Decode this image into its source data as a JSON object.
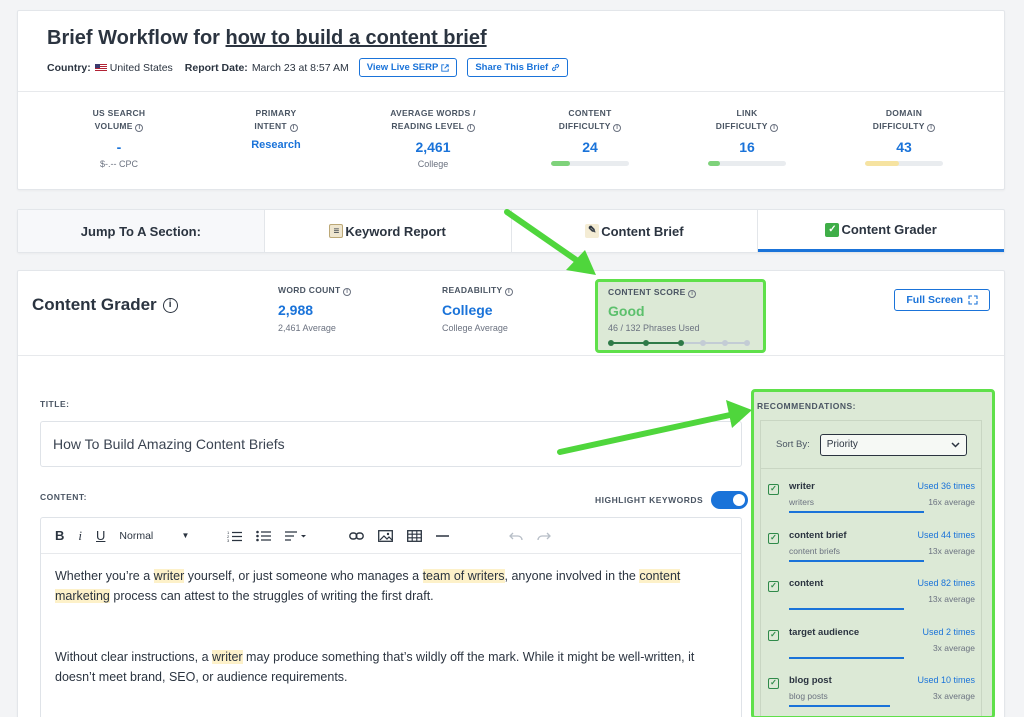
{
  "header": {
    "title_prefix": "Brief Workflow for ",
    "title_topic": "how to build a content brief",
    "country_label": "Country:",
    "country_value": "United States",
    "report_date_label": "Report Date:",
    "report_date_value": "March 23 at 8:57 AM",
    "view_serp_label": "View Live SERP",
    "share_label": "Share This Brief"
  },
  "metrics": {
    "search_volume": {
      "label1": "US SEARCH",
      "label2": "VOLUME",
      "value": "-",
      "sub": "$-.-- CPC"
    },
    "primary_intent": {
      "label1": "PRIMARY",
      "label2": "INTENT",
      "value": "Research"
    },
    "avg_words": {
      "label1": "AVERAGE WORDS /",
      "label2": "READING LEVEL",
      "value": "2,461",
      "sub": "College"
    },
    "content_difficulty": {
      "label1": "CONTENT",
      "label2": "DIFFICULTY",
      "value": "24",
      "level": 0.24
    },
    "link_difficulty": {
      "label1": "LINK",
      "label2": "DIFFICULTY",
      "value": "16",
      "level": 0.16
    },
    "domain_difficulty": {
      "label1": "DOMAIN",
      "label2": "DIFFICULTY",
      "value": "43",
      "level": 0.43
    }
  },
  "colors": {
    "accent": "#1a73d9",
    "good": "#5cc06c",
    "highlight": "#5fe04a",
    "difficulty_low": "#7ed27a",
    "difficulty_mid": "#f6e3a1"
  },
  "tabs": {
    "jump": "Jump To A Section:",
    "keyword_report": "Keyword Report",
    "content_brief": "Content Brief",
    "content_grader": "Content Grader"
  },
  "grader": {
    "title": "Content Grader",
    "word_count": {
      "label": "WORD COUNT",
      "value": "2,988",
      "sub": "2,461 Average"
    },
    "readability": {
      "label": "READABILITY",
      "value": "College",
      "sub": "College Average"
    },
    "content_score": {
      "label": "CONTENT SCORE",
      "value": "Good",
      "sub": "46 / 132 Phrases Used",
      "steps_filled": 3,
      "steps_total": 6
    },
    "full_screen_label": "Full Screen",
    "title_label": "TITLE:",
    "title_value": "How To Build Amazing Content Briefs",
    "content_label": "CONTENT:",
    "highlight_label": "HIGHLIGHT KEYWORDS",
    "toolbar": {
      "format": "Normal"
    },
    "paragraph1": {
      "t1": "Whether you’re a ",
      "k1": "writer",
      "t2": " yourself, or just someone who manages a ",
      "k2": "team of writers",
      "t3": ", anyone involved in the ",
      "k3": "content marketing",
      "t4": " process can attest to the struggles of writing the first draft."
    },
    "paragraph2": {
      "t1": "Without clear instructions, a ",
      "k1": "writer",
      "t2": " may produce something that’s wildly off the mark. While it might be well-written, it doesn’t meet brand, SEO, or audience requirements."
    }
  },
  "recommendations": {
    "label": "RECOMMENDATIONS:",
    "sort_label": "Sort By:",
    "sort_value": "Priority",
    "items": [
      {
        "name": "writer",
        "used": "Used 36 times",
        "variant": "writers",
        "avg": "16x average",
        "progress": 1.0
      },
      {
        "name": "content brief",
        "used": "Used 44 times",
        "variant": "content briefs",
        "avg": "13x average",
        "progress": 1.0
      },
      {
        "name": "content",
        "used": "Used 82 times",
        "variant": "",
        "avg": "13x average",
        "progress": 0.85
      },
      {
        "name": "target audience",
        "used": "Used 2 times",
        "variant": "",
        "avg": "3x average",
        "progress": 0.85
      },
      {
        "name": "blog post",
        "used": "Used 10 times",
        "variant": "blog posts",
        "avg": "3x average",
        "progress": 0.75
      }
    ]
  }
}
